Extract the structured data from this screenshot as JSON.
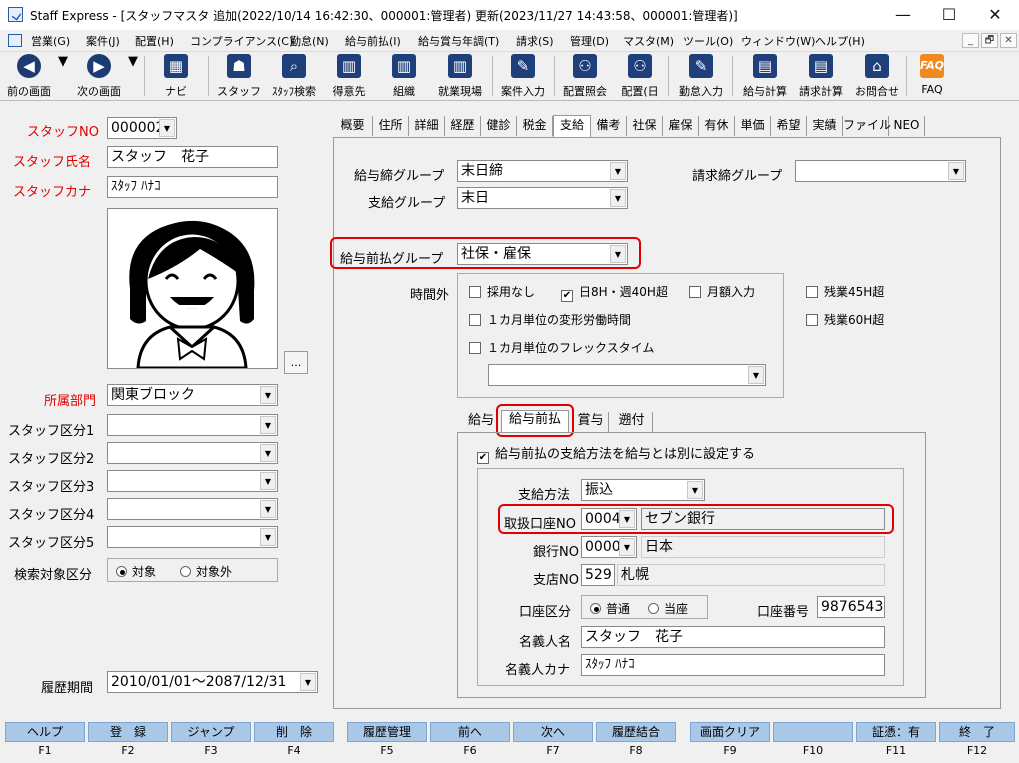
{
  "window": {
    "title": "Staff Express - [スタッフマスタ 追加(2022/10/14 16:42:30、000001:管理者) 更新(2023/11/27 14:43:58、000001:管理者)]",
    "minimize": "—",
    "maximize": "☐",
    "close": "✕"
  },
  "menu": [
    "営業(G)",
    "案件(J)",
    "配置(H)",
    "コンプライアンス(C)",
    "勤怠(N)",
    "給与前払(I)",
    "給与賞与年調(T)",
    "請求(S)",
    "管理(D)",
    "マスタ(M)",
    "ツール(O)",
    "ウィンドウ(W)",
    "ヘルプ(H)"
  ],
  "mdi": [
    "_",
    "🗗",
    "✕"
  ],
  "toolbar": {
    "prev": "前の画面",
    "next": "次の画面",
    "navi": "ナビ",
    "staff": "スタッフ",
    "staff_search": "ｽﾀｯﾌ検索",
    "client": "得意先",
    "org": "組織",
    "site": "就業現場",
    "case_input": "案件入力",
    "assign_ref": "配置照会",
    "assign_day": "配置(日",
    "attendance_input": "勤怠入力",
    "salary_calc": "給与計算",
    "billing_calc": "請求計算",
    "inquiry": "お問合せ",
    "faq": "FAQ",
    "faq_glyph": "FAQ"
  },
  "left": {
    "staff_no_label": "スタッフNO",
    "staff_no": "000002",
    "staff_name_label": "スタッフ氏名",
    "staff_name": "スタッフ　花子",
    "staff_kana_label": "スタッフカナ",
    "staff_kana": "ｽﾀｯﾌ ﾊﾅｺ",
    "photo_button": "...",
    "dept_label": "所属部門",
    "dept": "関東ブロック",
    "class1_label": "スタッフ区分1",
    "class2_label": "スタッフ区分2",
    "class3_label": "スタッフ区分3",
    "class4_label": "スタッフ区分4",
    "class5_label": "スタッフ区分5",
    "search_target_label": "検索対象区分",
    "search_target_on": "対象",
    "search_target_off": "対象外",
    "history_label": "履歴期間",
    "history_value": "2010/01/01～2087/12/31"
  },
  "tabs": [
    "概要",
    "住所",
    "詳細",
    "経歴",
    "健診",
    "税金",
    "支給",
    "備考",
    "社保",
    "雇保",
    "有休",
    "単価",
    "希望",
    "実績",
    "ファイル",
    "NEO"
  ],
  "main": {
    "payroll_close_group_label": "給与締グループ",
    "payroll_close_group": "末日締",
    "billing_close_group_label": "請求締グループ",
    "billing_close_group": "",
    "pay_group_label": "支給グループ",
    "pay_group": "末日",
    "advance_group_label": "給与前払グループ",
    "advance_group": "社保・雇保",
    "overtime_label": "時間外",
    "ot_none": "採用なし",
    "ot_daily": "日8H・週40H超",
    "ot_monthly": "月額入力",
    "ot_45": "残業45H超",
    "ot_60": "残業60H超",
    "ot_variable": "１カ月単位の変形労働時間",
    "ot_flex": "１カ月単位のフレックスタイム"
  },
  "subtabs": [
    "給与",
    "給与前払",
    "賞与",
    "遡付"
  ],
  "advance": {
    "separate_label": "給与前払の支給方法を給与とは別に設定する",
    "method_label": "支給方法",
    "method": "振込",
    "account_label": "取扱口座NO",
    "account_no": "0004",
    "account_name": "セブン銀行",
    "bank_label": "銀行NO",
    "bank_no": "0000",
    "bank_name": "日本",
    "branch_label": "支店NO",
    "branch_no": "529",
    "branch_name": "札幌",
    "acct_type_label": "口座区分",
    "acct_normal": "普通",
    "acct_current": "当座",
    "acct_number_label": "口座番号",
    "acct_number": "9876543",
    "holder_label": "名義人名",
    "holder": "スタッフ　花子",
    "holder_kana_label": "名義人カナ",
    "holder_kana": "ｽﾀｯﾌ ﾊﾅｺ"
  },
  "fkeys": [
    {
      "label": "ヘルプ",
      "key": "F1"
    },
    {
      "label": "登　録",
      "key": "F2"
    },
    {
      "label": "ジャンプ",
      "key": "F3"
    },
    {
      "label": "削　除",
      "key": "F4"
    },
    {
      "label": "履歴管理",
      "key": "F5"
    },
    {
      "label": "前へ",
      "key": "F6"
    },
    {
      "label": "次へ",
      "key": "F7"
    },
    {
      "label": "履歴結合",
      "key": "F8"
    },
    {
      "label": "画面クリア",
      "key": "F9"
    },
    {
      "label": "",
      "key": "F10"
    },
    {
      "label": "証憑：有",
      "key": "F11"
    },
    {
      "label": "終　了",
      "key": "F12"
    }
  ],
  "colors": {
    "highlight": "#e00000",
    "fkey_bg": "#a9c8e8",
    "label_red": "#e00000"
  }
}
